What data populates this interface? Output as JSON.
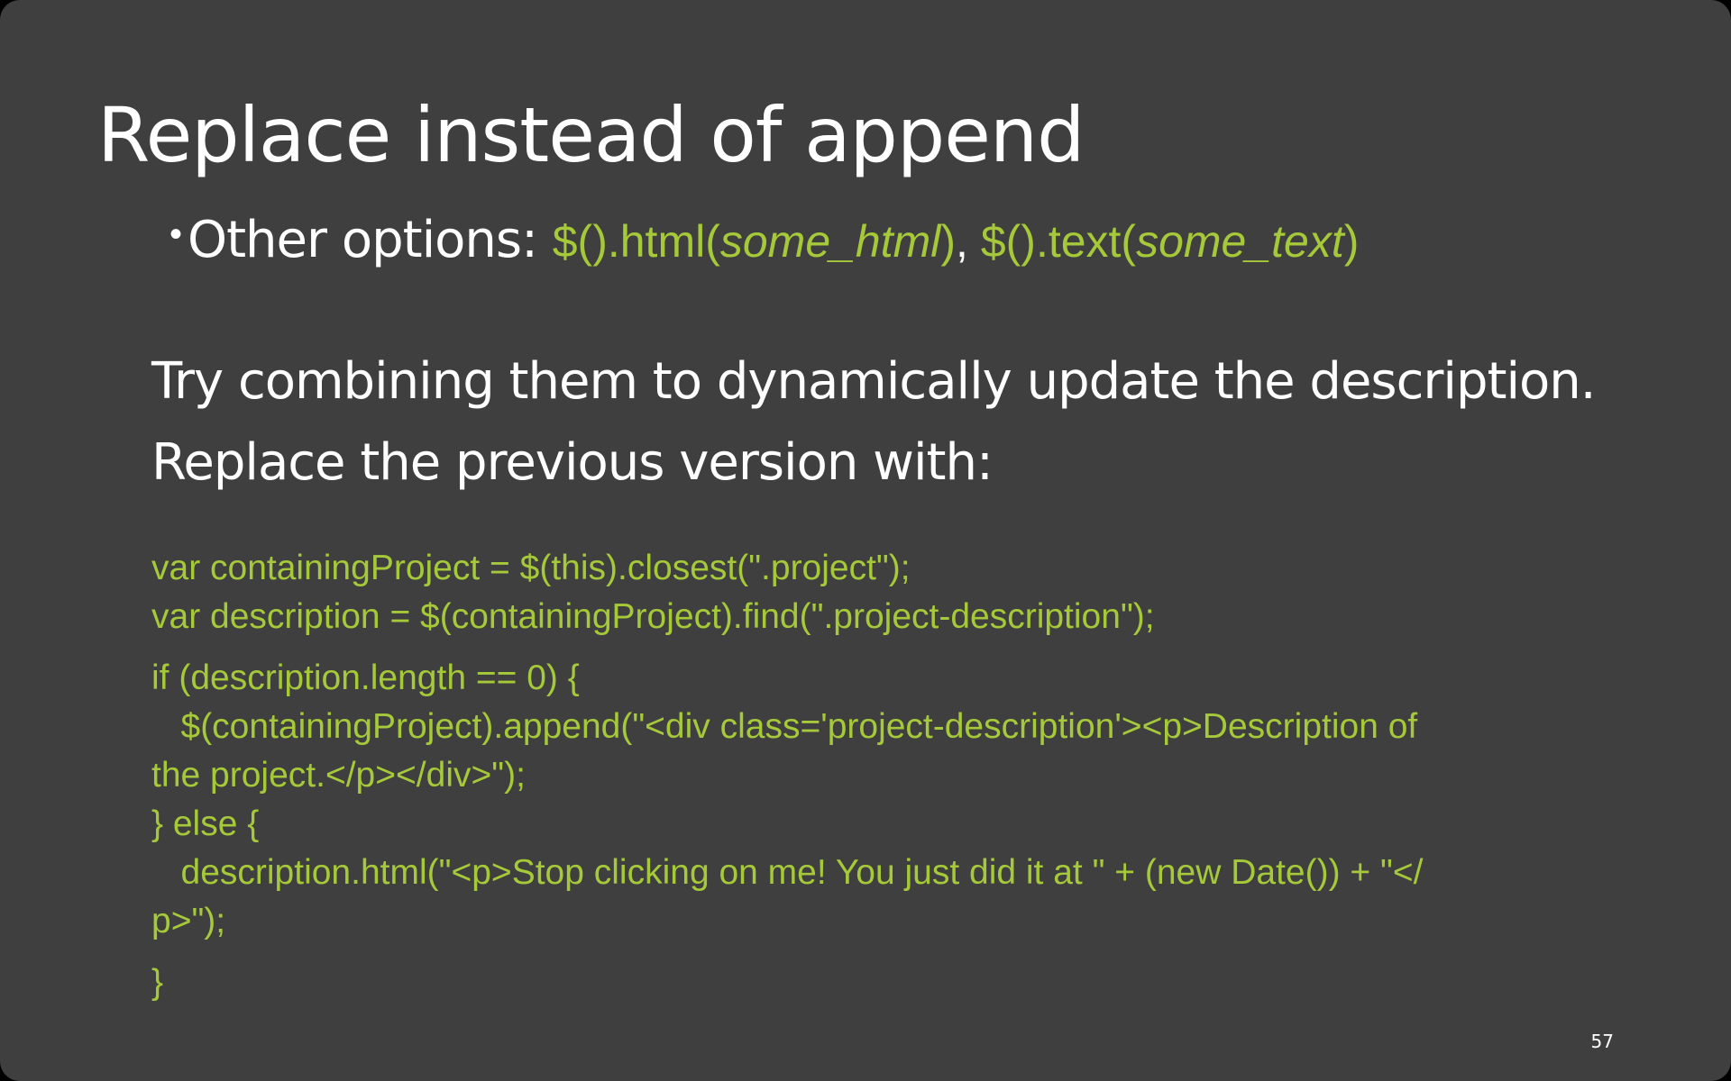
{
  "slide": {
    "title": "Replace instead of append",
    "bullet": {
      "marker": "•",
      "label": "Other options: ",
      "option1_prefix": "$().html(",
      "option1_arg": "some_html",
      "option1_suffix": ")",
      "separator": ",  ",
      "option2_prefix": "$().text(",
      "option2_arg": "some_text",
      "option2_suffix": ")"
    },
    "paragraph1": "Try combining them to dynamically update the description.",
    "paragraph2": "Replace the previous version with:",
    "code_lines": [
      "var containingProject = $(this).closest(\".project\");",
      "var description = $(containingProject).find(\".project-description\");",
      "if (description.length == 0) {",
      "   $(containingProject).append(\"<div class='project-description'><p>Description of",
      "the project.</p></div>\");",
      "} else {",
      "   description.html(\"<p>Stop clicking on me! You just did it at \" + (new Date()) + \"</",
      "p>\");",
      "}"
    ],
    "slide_number": "57",
    "colors": {
      "background": "#3f3f3f",
      "text": "#ffffff",
      "code": "#a6c93a"
    }
  }
}
